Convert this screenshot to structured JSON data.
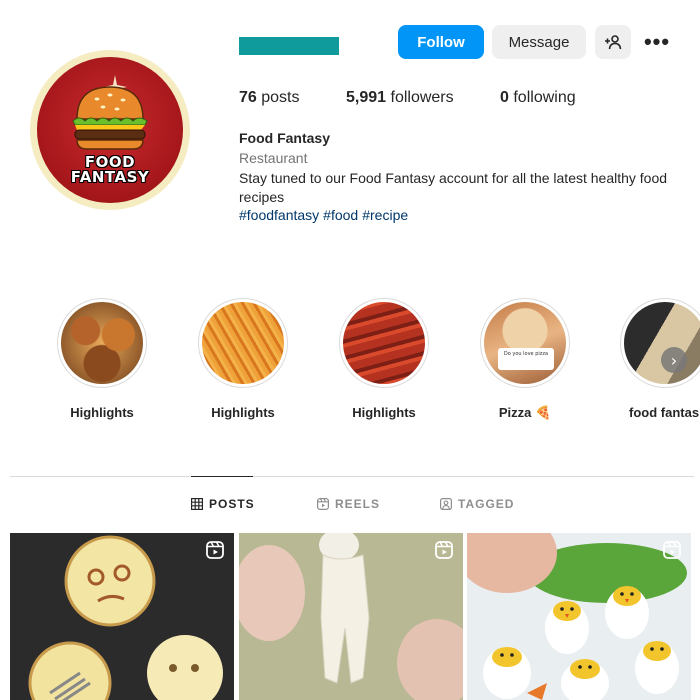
{
  "profile": {
    "follow_label": "Follow",
    "message_label": "Message",
    "more_label": "•••",
    "posts_count": "76",
    "posts_label": "posts",
    "followers_count": "5,991",
    "followers_label": "followers",
    "following_count": "0",
    "following_label": "following",
    "name": "Food Fantasy",
    "category": "Restaurant",
    "bio": "Stay tuned to our Food Fantasy account for all the latest healthy food recipes",
    "hashtags": [
      "#foodfantasy",
      "#food",
      "#recipe"
    ],
    "logo_line1": "FOOD",
    "logo_line2": "FANTASY"
  },
  "highlights": [
    {
      "label": "Highlights"
    },
    {
      "label": "Highlights"
    },
    {
      "label": "Highlights"
    },
    {
      "label": "Pizza 🍕",
      "card_text": "Do you love pizza"
    },
    {
      "label": "food fantas"
    }
  ],
  "tabs": [
    {
      "label": "POSTS",
      "active": true
    },
    {
      "label": "REELS",
      "active": false
    },
    {
      "label": "TAGGED",
      "active": false
    }
  ],
  "colors": {
    "follow_button": "#0095f6",
    "username_redacted": "#0f9b9c",
    "avatar_red": "#a4161a",
    "hashtag": "#00376b"
  },
  "icons": {
    "add_user": "add-user-icon",
    "more": "more-options-icon",
    "posts_tab": "grid-icon",
    "reels_tab": "reels-icon",
    "tagged_tab": "tagged-icon",
    "reel_badge": "reel-icon",
    "next": "chevron-right-icon"
  }
}
